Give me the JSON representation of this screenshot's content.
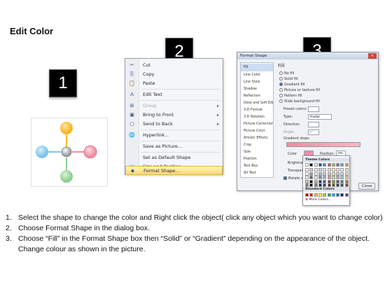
{
  "title": "Edit Color",
  "badges": [
    "1",
    "2",
    "3"
  ],
  "diagram": {
    "colors": {
      "top": "#f2b829",
      "left": "#7fc3ec",
      "right": "#f08ea4",
      "bottom": "#8ed08f",
      "center": "#a8aab0"
    }
  },
  "context_menu": {
    "items": [
      {
        "icon": "✂",
        "label": "Cut",
        "arrow": "",
        "disabled": false
      },
      {
        "icon": "⎘",
        "label": "Copy",
        "arrow": "",
        "disabled": false
      },
      {
        "icon": "📋",
        "label": "Paste",
        "arrow": "",
        "disabled": false
      },
      {
        "icon": "A",
        "label": "Edit Text",
        "arrow": "",
        "disabled": false
      },
      {
        "icon": "⊞",
        "label": "Group",
        "arrow": "▸",
        "disabled": true
      },
      {
        "icon": "▣",
        "label": "Bring to Front",
        "arrow": "▸",
        "disabled": false
      },
      {
        "icon": "▢",
        "label": "Send to Back",
        "arrow": "▸",
        "disabled": false
      },
      {
        "icon": "🌐",
        "label": "Hyperlink...",
        "arrow": "",
        "disabled": false
      },
      {
        "icon": "",
        "label": "Save as Picture...",
        "arrow": "",
        "disabled": false
      },
      {
        "icon": "",
        "label": "Set as Default Shape",
        "arrow": "",
        "disabled": false
      },
      {
        "icon": "⇲",
        "label": "Size and Position...",
        "arrow": "",
        "disabled": false
      },
      {
        "icon": "◆",
        "label": "Format Shape...",
        "arrow": "",
        "disabled": false
      }
    ]
  },
  "dialog": {
    "title": "Format Shape",
    "categories": [
      "Fill",
      "Line Color",
      "Line Style",
      "Shadow",
      "Reflection",
      "Glow and Soft Edges",
      "3-D Format",
      "3-D Rotation",
      "Picture Corrections",
      "Picture Color",
      "Artistic Effects",
      "Crop",
      "Size",
      "Position",
      "Text Box",
      "Alt Text"
    ],
    "fill_heading": "Fill",
    "fill_options": [
      "No fill",
      "Solid fill",
      "Gradient fill",
      "Picture or texture fill",
      "Pattern fill",
      "Slide background fill"
    ],
    "selected_fill": "Gradient fill",
    "preset_colors_label": "Preset colors:",
    "type_label": "Type:",
    "type_value": "Radial",
    "direction_label": "Direction:",
    "angle_label": "Angle:",
    "angle_value": "0°",
    "gradient_stops_label": "Gradient stops",
    "color_label": "Color",
    "position_label": "Position:",
    "position_value": "0%",
    "brightness_label": "Brightness",
    "transparency_label": "Transparency",
    "rotate_label": "Rotate with shape",
    "close_label": "Close"
  },
  "color_popup": {
    "theme_colors_label": "Theme Colors",
    "standard_colors_label": "Standard Colors",
    "more_colors_label": "More Colors...",
    "theme_row": [
      "#ffffff",
      "#000000",
      "#eeece1",
      "#1f497d",
      "#4f81bd",
      "#c0504d",
      "#9bbb59",
      "#8064a2",
      "#4bacc6",
      "#f79646"
    ],
    "standard_row": [
      "#c00000",
      "#ff0000",
      "#ffc000",
      "#ffff00",
      "#92d050",
      "#00b050",
      "#00b0f0",
      "#0070c0",
      "#002060",
      "#7030a0"
    ]
  },
  "instructions": [
    {
      "num": "1.",
      "text": "Select the shape to change the color and Right click the object( click any object which you want to change color)"
    },
    {
      "num": "2.",
      "text": "Choose Format Shape in the dialog box."
    },
    {
      "num": "3.",
      "text": "Choose “Fill” in the Format Shape box then “Solid” or “Gradient” depending on the appearance of the object. Change colour as shown in the picture."
    }
  ]
}
